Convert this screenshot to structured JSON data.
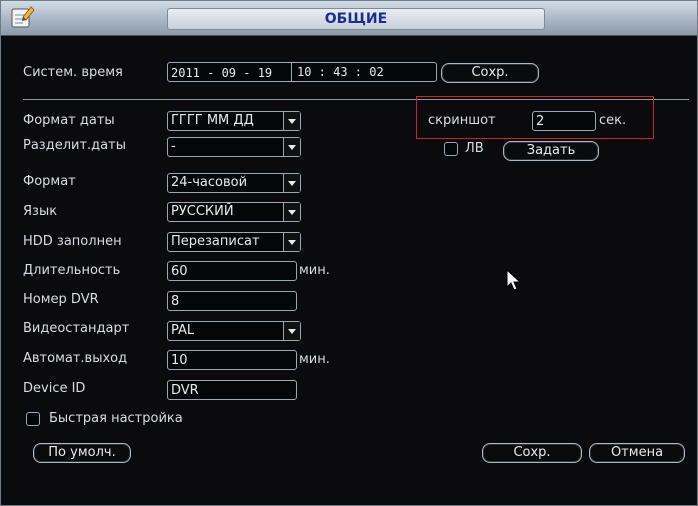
{
  "window": {
    "title": "ОБЩИЕ"
  },
  "system_time": {
    "label": "Систем. время",
    "date": "2011  - 09 - 19",
    "time": "10 : 43 : 02",
    "save_label": "Сохр."
  },
  "settings": {
    "date_format": {
      "label": "Формат даты",
      "value": "ГГГГ ММ ДД"
    },
    "date_separator": {
      "label": "Разделит.даты",
      "value": "-"
    },
    "time_format": {
      "label": "Формат",
      "value": "24-часовой"
    },
    "language": {
      "label": "Язык",
      "value": "РУССКИЙ"
    },
    "hdd_full": {
      "label": "HDD заполнен",
      "value": "Перезаписат"
    },
    "duration": {
      "label": "Длительность",
      "value": "60",
      "unit": "мин."
    },
    "dvr_number": {
      "label": "Номер DVR",
      "value": "8"
    },
    "video_standard": {
      "label": "Видеостандарт",
      "value": "PAL"
    },
    "auto_logout": {
      "label": "Автомат.выход",
      "value": "10",
      "unit": "мин."
    },
    "device_id": {
      "label": "Device ID",
      "value": "DVR"
    },
    "quick_setup": {
      "label": "Быстрая настройка",
      "checked": false
    }
  },
  "snapshot": {
    "label": "скриншот",
    "value": "2",
    "unit": "сек."
  },
  "dst": {
    "label": "ЛВ",
    "checked": false,
    "set_label": "Задать"
  },
  "footer": {
    "default_label": "По умолч.",
    "save_label": "Сохр.",
    "cancel_label": "Отмена"
  },
  "icons": {
    "app": "pencil-notepad-icon",
    "pointer": "mouse-pointer-icon"
  },
  "colors": {
    "highlight_box": "#c7223a",
    "title_text": "#1e2d8c"
  }
}
